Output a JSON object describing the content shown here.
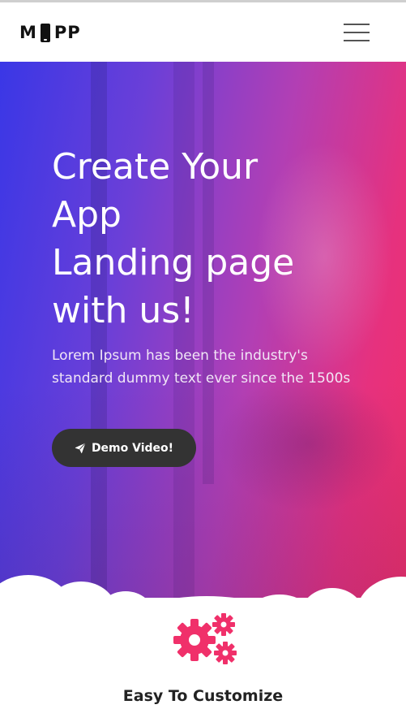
{
  "header": {
    "logo_left": "M",
    "logo_right": "PP",
    "menu_icon": "hamburger-menu-icon"
  },
  "hero": {
    "title_lines": [
      "Create Your",
      "App",
      "Landing page",
      "with us!"
    ],
    "text": "Lorem Ipsum has been the industry's standard dummy text ever since the 1500s",
    "button_label": "Demo Video!",
    "button_icon": "paper-plane-icon",
    "gradient_start": "#3a37e6",
    "gradient_end": "#f0306a"
  },
  "feature": {
    "icon": "gears-icon",
    "icon_color": "#f0306a",
    "title": "Easy To Customize"
  }
}
